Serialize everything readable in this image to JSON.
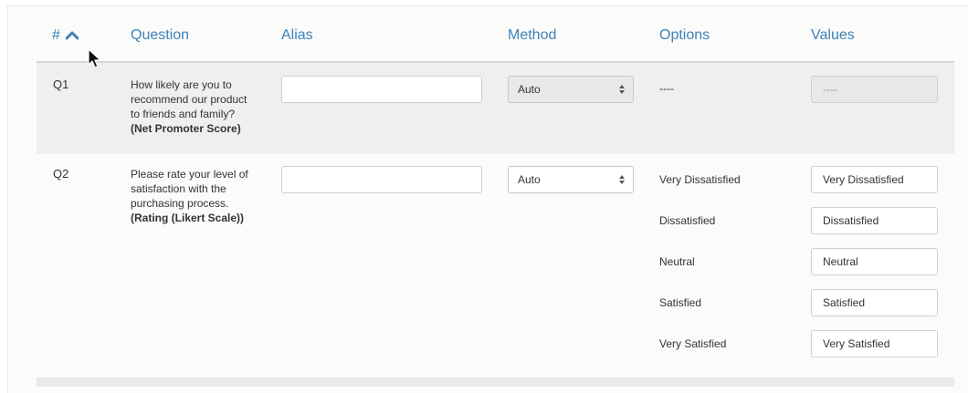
{
  "header": {
    "num": "#",
    "question": "Question",
    "alias": "Alias",
    "method": "Method",
    "options": "Options",
    "values": "Values"
  },
  "rows": [
    {
      "num": "Q1",
      "question_lines": [
        "How likely are you to",
        "recommend our product",
        "to friends and family?"
      ],
      "question_type": "(Net Promoter Score)",
      "alias": "",
      "method": "Auto",
      "options": [
        "----"
      ],
      "values": [
        "----"
      ]
    },
    {
      "num": "Q2",
      "question_lines": [
        "Please rate your level of",
        "satisfaction with the",
        "purchasing process."
      ],
      "question_type": "(Rating (Likert Scale))",
      "alias": "",
      "method": "Auto",
      "options": [
        "Very Dissatisfied",
        "Dissatisfied",
        "Neutral",
        "Satisfied",
        "Very Satisfied"
      ],
      "values": [
        "Very Dissatisfied",
        "Dissatisfied",
        "Neutral",
        "Satisfied",
        "Very Satisfied"
      ]
    }
  ],
  "colors": {
    "header_text": "#3d82b8",
    "row_highlight": "#efefef"
  }
}
